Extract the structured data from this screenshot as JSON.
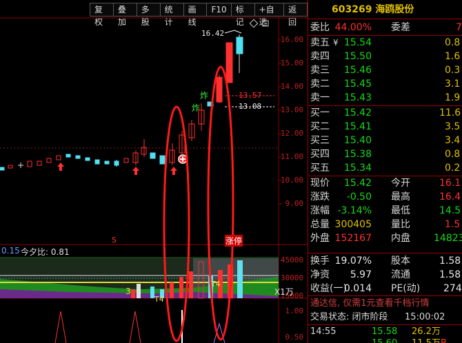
{
  "toolbar": [
    "复权",
    "叠加",
    "多股",
    "统计",
    "画线",
    "F10",
    "标记",
    "+自选",
    "返回"
  ],
  "chart": {
    "price_axis": [
      "16.00",
      "15.00",
      "14.00",
      "13.00",
      "12.00",
      "11.00",
      "10.00",
      "9.00"
    ],
    "high_tag": "16.42",
    "tag_a": "13.57",
    "tag_b": "13.08",
    "vol_header_val": "0.15",
    "vol_header_text": "今夕比: 0.81",
    "vol_axis": [
      "45000",
      "30000",
      "15000"
    ],
    "vol_unit": "X1万",
    "ind_axis": [
      "1.00",
      "0.50"
    ],
    "marker_s": "S",
    "marker_zt": "涨停",
    "marker_3": "3",
    "marker_t4a": "T4",
    "marker_t4b": "T4",
    "marker_zha": "炸",
    "marker_zhb": "炸"
  },
  "quote": {
    "code": "603269",
    "name": "海鸥股份",
    "weibi_label": "委比",
    "weibi_value": "44.00%",
    "weicha_label": "委差",
    "weicha_value": "7",
    "asks": [
      {
        "label": "卖五",
        "price": "15.54",
        "vol": "0.8",
        "flag": "¥"
      },
      {
        "label": "卖四",
        "price": "15.50",
        "vol": "1.6",
        "flag": ""
      },
      {
        "label": "卖三",
        "price": "15.46",
        "vol": "0.3",
        "flag": ""
      },
      {
        "label": "卖二",
        "price": "15.45",
        "vol": "3.1",
        "flag": ""
      },
      {
        "label": "卖一",
        "price": "15.43",
        "vol": "1.9",
        "flag": ""
      }
    ],
    "bids": [
      {
        "label": "买一",
        "price": "15.42",
        "vol": "11.6"
      },
      {
        "label": "买二",
        "price": "15.41",
        "vol": "3.5"
      },
      {
        "label": "买三",
        "price": "15.40",
        "vol": "3.4"
      },
      {
        "label": "买四",
        "price": "15.38",
        "vol": "0.8"
      },
      {
        "label": "买五",
        "price": "15.34",
        "vol": "0.2"
      }
    ],
    "stats1": [
      {
        "l1": "现价",
        "v1": "15.42",
        "l2": "今开",
        "v2": "16.1"
      },
      {
        "l1": "涨跌",
        "v1": "-0.50",
        "l2": "最高",
        "v2": "16.4"
      },
      {
        "l1": "涨幅",
        "v1": "-3.14%",
        "l2": "最低",
        "v2": "14.5"
      },
      {
        "l1": "总量",
        "v1": "300405",
        "l2": "量比",
        "v2": "1.5"
      },
      {
        "l1": "外盘",
        "v1": "152167",
        "l2": "内盘",
        "v2": "14823"
      }
    ],
    "stats2": [
      {
        "l1": "换手",
        "v1": "19.07%",
        "l2": "股本",
        "v2": "1.58"
      },
      {
        "l1": "净资",
        "v1": "5.97",
        "l2": "流通",
        "v2": "1.58"
      },
      {
        "l1": "收益(一)",
        "v1": "0.014",
        "l2": "PE(动)",
        "v2": "274"
      }
    ],
    "notice": "通达信, 仅需1元查看千档行情",
    "status_label": "交易状态: 闭市阶段",
    "status_time": "15:00:02",
    "ticks": [
      {
        "time": "14:55",
        "price": "15.58",
        "vol": "26.2万",
        "side": ""
      },
      {
        "time": "",
        "price": "15.60",
        "vol": "11.5万",
        "side": "B"
      },
      {
        "time": "",
        "price": "15.59",
        "vol": "20.3万",
        "side": "S"
      }
    ]
  }
}
